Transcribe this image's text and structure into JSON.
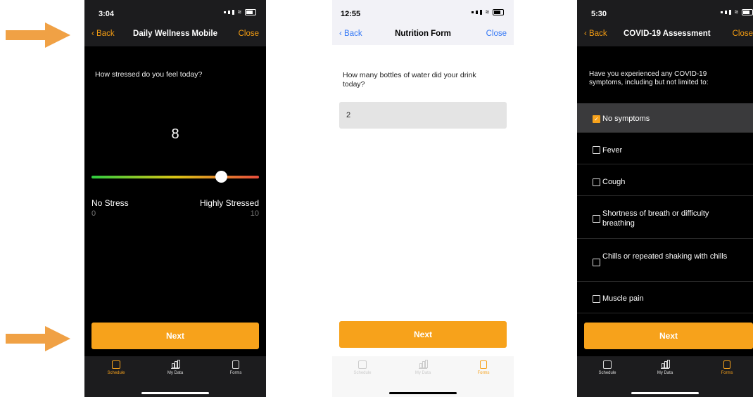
{
  "phones": [
    {
      "status": {
        "time": "3:04"
      },
      "nav": {
        "back": "Back",
        "title": "Daily Wellness Mobile",
        "close": "Close"
      },
      "question": "How stressed do you feel today?",
      "slider": {
        "value": "8",
        "value_fraction": 0.79,
        "min_label": "No Stress",
        "max_label": "Highly Stressed",
        "min_value": "0",
        "max_value": "10"
      },
      "next": "Next",
      "tabs": [
        {
          "label": "Schedule",
          "active": true
        },
        {
          "label": "My Data",
          "active": false
        },
        {
          "label": "Forms",
          "active": false
        }
      ]
    },
    {
      "status": {
        "time": "12:55"
      },
      "nav": {
        "back": "Back",
        "title": "Nutrition Form",
        "close": "Close"
      },
      "question": "How many bottles of water did your drink today?",
      "input_value": "2",
      "next": "Next",
      "tabs": [
        {
          "label": "Schedule",
          "active": false
        },
        {
          "label": "My Data",
          "active": false
        },
        {
          "label": "Forms",
          "active": true
        }
      ]
    },
    {
      "status": {
        "time": "5:30"
      },
      "nav": {
        "back": "Back",
        "title": "COVID-19 Assessment",
        "close": "Close"
      },
      "question": "Have you experienced any COVID-19 symptoms, including but not limited to:",
      "options": [
        {
          "label": "No symptoms",
          "checked": true
        },
        {
          "label": "Fever",
          "checked": false
        },
        {
          "label": "Cough",
          "checked": false
        },
        {
          "label": "Shortness of breath or difficulty breathing",
          "checked": false
        },
        {
          "label": "Chills or repeated shaking with chills",
          "checked": false
        },
        {
          "label": "Muscle pain",
          "checked": false
        }
      ],
      "next": "Next",
      "tabs": [
        {
          "label": "Schedule",
          "active": false
        },
        {
          "label": "My Data",
          "active": false
        },
        {
          "label": "Forms",
          "active": true
        }
      ]
    }
  ],
  "colors": {
    "accent": "#f7a21b",
    "arrow": "#f0a145"
  }
}
